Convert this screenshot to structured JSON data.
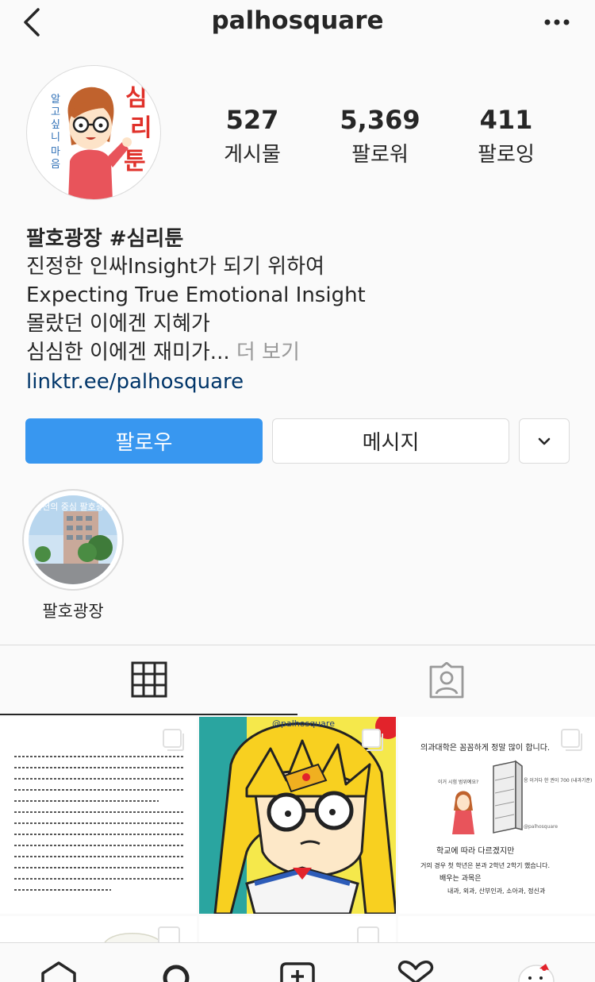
{
  "header": {
    "username": "palhosquare",
    "back_icon": "chevron-left-icon",
    "more_icon": "more-horizontal-icon"
  },
  "profile": {
    "avatar_icon": "psychotoon-avatar",
    "avatar_text_vertical": "알고싶니마음",
    "avatar_text_title": "심리툰",
    "stats": [
      {
        "value": "527",
        "label": "게시물"
      },
      {
        "value": "5,369",
        "label": "팔로워"
      },
      {
        "value": "411",
        "label": "팔로잉"
      }
    ]
  },
  "bio": {
    "name": "팔호광장 #심리툰",
    "lines": [
      "진정한 인싸Insight가 되기 위하여",
      "Expecting True Emotional Insight",
      "몰랐던 이에겐 지혜가"
    ],
    "last_line": "심심한 이에겐 재미가...",
    "more_label": "더 보기",
    "link": "linktr.ee/palhosquare"
  },
  "actions": {
    "follow_label": "팔로우",
    "message_label": "메시지",
    "dropdown_icon": "chevron-down-icon"
  },
  "highlights": [
    {
      "label": "팔호광장",
      "overlay_text": "춘천의 중심 팔호광장"
    }
  ],
  "tabs": [
    {
      "name": "grid",
      "icon": "grid-icon",
      "active": true
    },
    {
      "name": "tagged",
      "icon": "tagged-person-icon",
      "active": false
    }
  ],
  "posts": [
    {
      "type": "text-page",
      "multi": true
    },
    {
      "type": "illustration",
      "watermark": "@palhosquare",
      "multi": true
    },
    {
      "type": "comic",
      "multi": true,
      "heading": "의과대학은 꼼꼼하게 정말 많이 합니다.",
      "bubble_left": "이거 시험 범위예요?",
      "bubble_right": "응 이거다 한 권이 700 (내과기준)",
      "line1": "학교에 따라 다르겠지만",
      "line2": "거의 경우 첫 학년은 본과 2학년 2학기 했습니다.",
      "line3": "배우는 과목은",
      "line4": "내과, 외과, 산부인과, 소아과, 정신과",
      "watermark": "@palhosquare"
    }
  ],
  "bottom_nav": [
    {
      "name": "home",
      "icon": "home-icon"
    },
    {
      "name": "search",
      "icon": "search-icon"
    },
    {
      "name": "new-post",
      "icon": "plus-square-icon"
    },
    {
      "name": "activity",
      "icon": "heart-icon"
    },
    {
      "name": "profile",
      "icon": "profile-avatar-icon"
    }
  ],
  "colors": {
    "primary_blue": "#3897f0",
    "link_blue": "#003569",
    "text": "#262626",
    "border": "#dbdbdb",
    "muted": "#999999",
    "background": "#fafafa"
  }
}
